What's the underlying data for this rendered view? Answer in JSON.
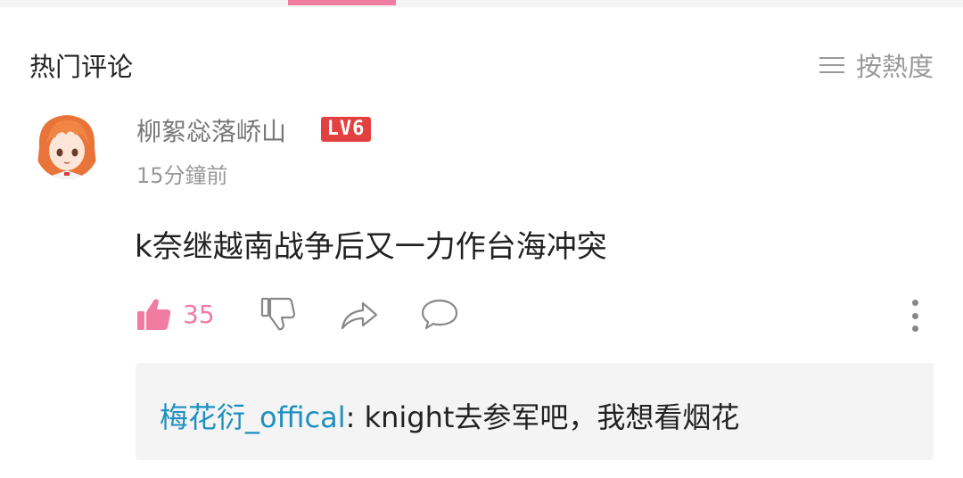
{
  "header": {
    "section_title": "热门评论",
    "sort_label": "按熱度",
    "sort_icon": "menu-lines-icon"
  },
  "comment": {
    "username": "柳絮惢落峤山",
    "level": "LV6",
    "time": "15分鐘前",
    "text": "k奈继越南战争后又一力作台海冲突",
    "like_count": "35",
    "icons": [
      "thumbs-up-icon",
      "thumbs-down-icon",
      "share-icon",
      "reply-bubble-icon",
      "more-icon"
    ]
  },
  "reply": {
    "author": "梅花衍_offical",
    "separator": ": ",
    "text": "knight去参军吧，我想看烟花"
  },
  "colors": {
    "accent": "#f07ca1",
    "link": "#1e90c0",
    "badge": "#e34040"
  }
}
